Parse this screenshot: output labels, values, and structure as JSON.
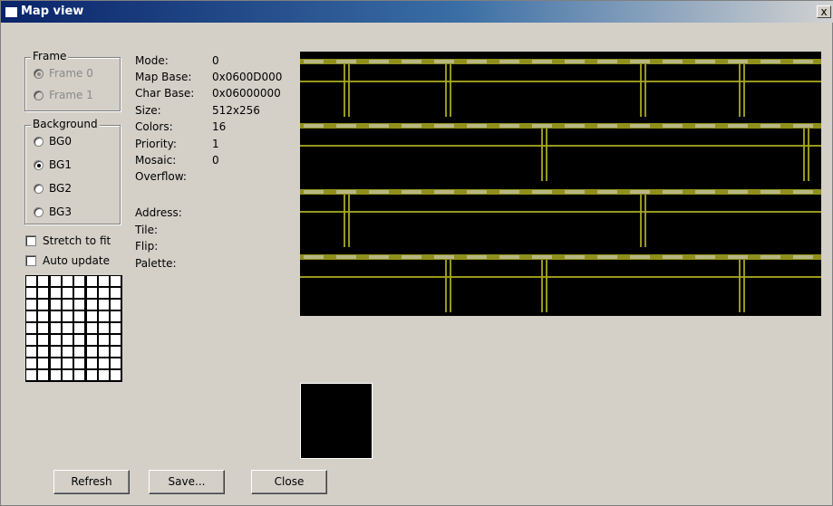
{
  "window": {
    "title": "Map view",
    "close_glyph": "x"
  },
  "frame_group": {
    "label": "Frame",
    "options": [
      {
        "label": "Frame 0",
        "checked": true,
        "disabled": true
      },
      {
        "label": "Frame 1",
        "checked": false,
        "disabled": true
      }
    ]
  },
  "background_group": {
    "label": "Background",
    "options": [
      {
        "label": "BG0",
        "checked": false
      },
      {
        "label": "BG1",
        "checked": true
      },
      {
        "label": "BG2",
        "checked": false
      },
      {
        "label": "BG3",
        "checked": false
      }
    ]
  },
  "checkboxes": {
    "stretch_to_fit": {
      "label": "Stretch to fit",
      "checked": false
    },
    "auto_update": {
      "label": "Auto update",
      "checked": false
    }
  },
  "info": {
    "mode": {
      "label": "Mode:",
      "value": "0"
    },
    "map_base": {
      "label": "Map Base:",
      "value": "0x0600D000"
    },
    "char_base": {
      "label": "Char Base:",
      "value": "0x06000000"
    },
    "size": {
      "label": "Size:",
      "value": "512x256"
    },
    "colors": {
      "label": "Colors:",
      "value": "16"
    },
    "priority": {
      "label": "Priority:",
      "value": "1"
    },
    "mosaic": {
      "label": "Mosaic:",
      "value": "0"
    },
    "overflow": {
      "label": "Overflow:",
      "value": ""
    },
    "address": {
      "label": "Address:",
      "value": ""
    },
    "tile": {
      "label": "Tile:",
      "value": ""
    },
    "flip": {
      "label": "Flip:",
      "value": ""
    },
    "palette": {
      "label": "Palette:",
      "value": ""
    }
  },
  "buttons": {
    "refresh": "Refresh",
    "save": "Save...",
    "close": "Close"
  },
  "colors": {
    "window_bg": "#d4d0c8",
    "title_start": "#0a246a",
    "map_bg": "#000000",
    "map_pattern": "#a8a820"
  },
  "icons": {
    "title": "window-icon",
    "close": "close-x-icon"
  }
}
